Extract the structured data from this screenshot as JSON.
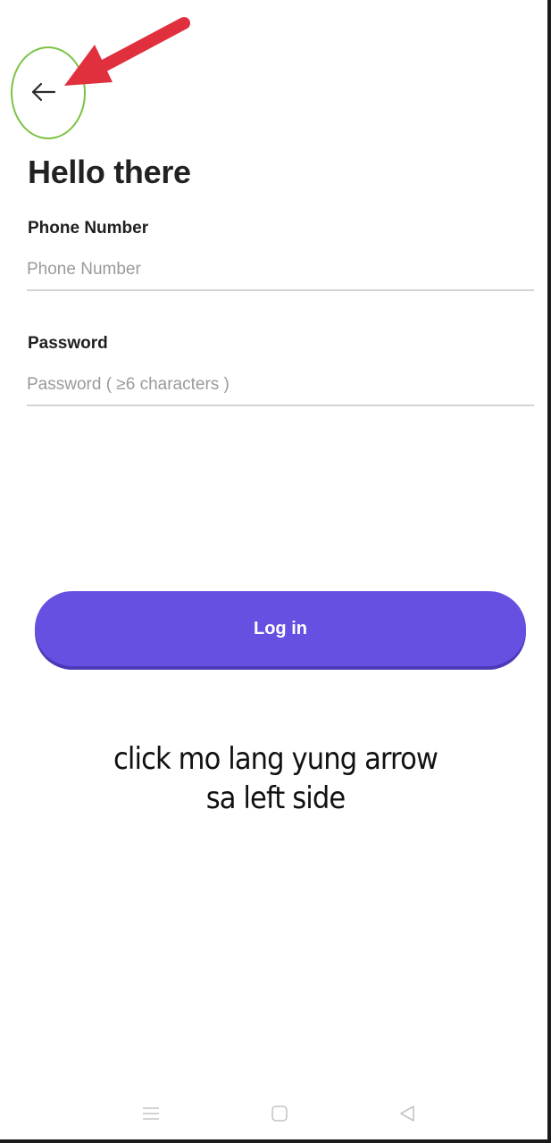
{
  "header": {
    "back_icon": "arrow-left-icon"
  },
  "page": {
    "title": "Hello there"
  },
  "form": {
    "phone": {
      "label": "Phone Number",
      "placeholder": "Phone Number",
      "value": ""
    },
    "password": {
      "label": "Password",
      "placeholder": "Password ( ≥6 characters )",
      "value": ""
    },
    "login_label": "Log in"
  },
  "annotation": {
    "line1": "click mo lang yung arrow",
    "line2": "sa left side",
    "circle_color": "#7cc243",
    "arrow_color": "#e0303e"
  },
  "nav_bar": {
    "icons": [
      "menu-icon",
      "home-square-icon",
      "back-triangle-icon"
    ]
  },
  "colors": {
    "accent": "#6550e1",
    "text": "#222222",
    "placeholder": "#9a9a9a",
    "divider": "#d4d4d4"
  }
}
